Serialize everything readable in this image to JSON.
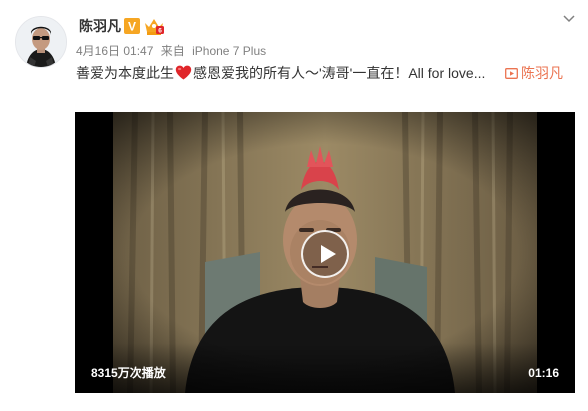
{
  "author": {
    "name": "陈羽凡",
    "verified_badge": "V",
    "avatar_icon": "avatar",
    "crown_badge_icon": "crown-badge-icon"
  },
  "meta": {
    "date": "4月16日 01:47",
    "source_prefix": "来自",
    "device": "iPhone 7 Plus"
  },
  "post": {
    "text_before_heart": "善爱为本度此生",
    "heart_icon": "red-heart-icon",
    "text_after_heart": "感恩爱我的所有人～'涛哥'一直在！All for love...",
    "video_link_icon": "video-play-icon",
    "video_link_text": "陈羽凡"
  },
  "video": {
    "play_count": "8315万次播放",
    "duration": "01:16",
    "play_button_icon": "play-icon"
  },
  "colors": {
    "link": "#eb7350",
    "verified": "#f6a623",
    "heart": "#e0262a"
  }
}
